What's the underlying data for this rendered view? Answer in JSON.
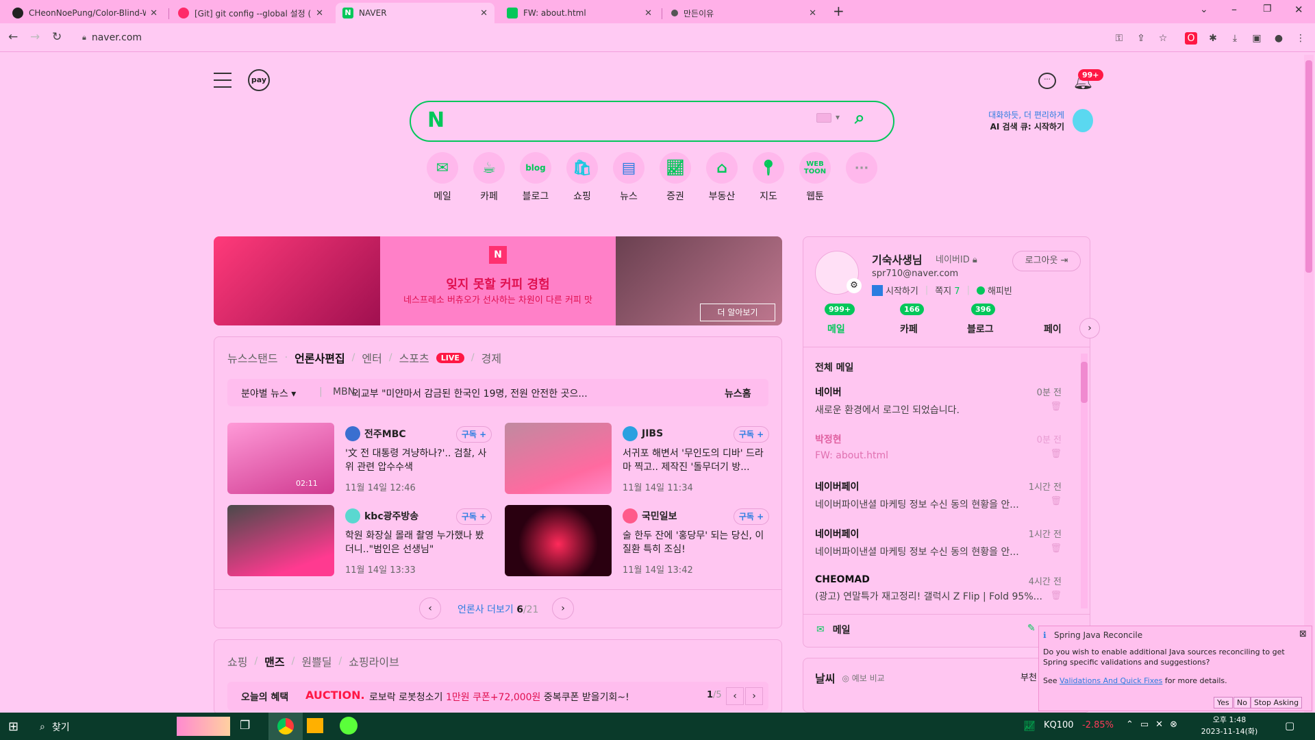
{
  "browser": {
    "tabs": [
      {
        "title": "CHeonNoePung/Color-Blind-W",
        "icon": "github-icon"
      },
      {
        "title": "[Git] git config --global 설정 (+",
        "icon": "tistory-icon"
      },
      {
        "title": "NAVER",
        "icon": "naver-icon"
      },
      {
        "title": "FW: about.html",
        "icon": "naver-mail-icon"
      },
      {
        "title": "만든이유",
        "icon": "eye-icon"
      }
    ],
    "url": "naver.com"
  },
  "naver": {
    "pay_label": "pay",
    "notif_count": "99+",
    "search_logo": "N",
    "ai_line1": "대화하듯, 더 편리하게",
    "ai_line2": "AI 검색 큐: 시작하기",
    "categories": [
      {
        "label": "메일",
        "icon": "mail-icon"
      },
      {
        "label": "카페",
        "icon": "cafe-icon"
      },
      {
        "label": "블로그",
        "icon": "blog-icon"
      },
      {
        "label": "쇼핑",
        "icon": "shopping-icon"
      },
      {
        "label": "뉴스",
        "icon": "news-icon"
      },
      {
        "label": "증권",
        "icon": "stock-icon"
      },
      {
        "label": "부동산",
        "icon": "realestate-icon"
      },
      {
        "label": "지도",
        "icon": "map-icon"
      },
      {
        "label": "웹툰",
        "icon": "webtoon-icon"
      }
    ],
    "more_icon": "···"
  },
  "ad": {
    "headline": "잊지 못할 커피 경험",
    "subline": "네스프레소 버츄오가 선사하는 차원이 다른 커피 맛",
    "cta": "더 알아보기",
    "brand_mark": "N"
  },
  "news": {
    "tabs": [
      "뉴스스탠드",
      "언론사편집",
      "엔터",
      "스포츠",
      "경제"
    ],
    "live": "LIVE",
    "ticker_category": "분야별 뉴스",
    "ticker_source": "MBN",
    "ticker_text": "외교부 \"미얀마서 감금된 한국인 19명, 전원 안전한 곳으...",
    "newshome": "뉴스홈",
    "subscribe": "구독 +",
    "items": [
      {
        "press": "전주MBC",
        "headline": "'文 전 대통령 겨냥하나?'.. 검찰, 사위 관련 압수수색",
        "date": "11월 14일 12:46",
        "video": "02:11"
      },
      {
        "press": "JIBS",
        "headline": "서귀포 해변서 '무인도의 디바' 드라마 찍고.. 제작진 '돌무더기 방...",
        "date": "11월 14일 11:34"
      },
      {
        "press": "kbc광주방송",
        "headline": "학원 화장실 몰래 촬영 누가했나 봤더니..\"범인은 선생님\"",
        "date": "11월 14일 13:33"
      },
      {
        "press": "국민일보",
        "headline": "술 한두 잔에 '홍당무' 되는 당신, 이 질환 특히 조심!",
        "date": "11월 14일 13:42"
      }
    ],
    "more_label": "언론사 더보기",
    "page": "6",
    "page_total": "/21"
  },
  "shopping": {
    "tabs": [
      "쇼핑",
      "맨즈",
      "원쁠딜",
      "쇼핑라이브"
    ],
    "promo_label": "오늘의 혜택",
    "promo_brand": "AUCTION.",
    "promo_text1": "로보락 로봇청소기",
    "promo_highlight": "1만원 쿠폰+72,000원",
    "promo_text2": "중복쿠폰 받을기회~!",
    "page": "1",
    "page_total": "/5"
  },
  "profile": {
    "name": "기숙사생님",
    "id_label": "네이버ID",
    "email": "spr710@naver.com",
    "logout": "로그아웃",
    "start": "시작하기",
    "memo_label": "쪽지",
    "memo_count": "7",
    "happybean": "해피빈",
    "services": [
      {
        "label": "메일",
        "count": "999+"
      },
      {
        "label": "카페",
        "count": "166"
      },
      {
        "label": "블로그",
        "count": "396"
      },
      {
        "label": "페이",
        "count": ""
      }
    ]
  },
  "mail": {
    "section_title": "전체 메일",
    "rows": [
      {
        "from": "네이버",
        "subject": "새로운 환경에서 로그인 되었습니다.",
        "time": "0분 전"
      },
      {
        "from": "박정현",
        "subject": "FW: about.html",
        "time": "0분 전"
      },
      {
        "from": "네이버페이",
        "subject": "네이버파이낸셜 마케팅 정보 수신 동의 현황을 안...",
        "time": "1시간 전"
      },
      {
        "from": "네이버페이",
        "subject": "네이버파이낸셜 마케팅 정보 수신 동의 현황을 안...",
        "time": "1시간 전"
      },
      {
        "from": "CHEOMAD",
        "subject": "(광고) 연말특가 재고정리! 갤럭시 Z Flip | Fold 95%...",
        "time": "4시간 전"
      }
    ],
    "footer_label": "메일"
  },
  "weather": {
    "title": "날씨",
    "compare": "예보 비교",
    "right": "부천"
  },
  "popup": {
    "title": "Spring Java Reconcile",
    "body": "Do you wish to enable additional Java sources reconciling to get Spring specific validations and suggestions?",
    "see": "See",
    "link": "Validations And Quick Fixes",
    "after": "for more details.",
    "btn_yes": "Yes",
    "btn_no": "No",
    "btn_stop": "Stop Asking"
  },
  "taskbar": {
    "search": "찾기",
    "stock_name": "KQ100",
    "stock_change": "-2.85%",
    "time": "오후 1:48",
    "date": "2023-11-14(화)"
  },
  "colors": {
    "naver_green": "#03c75a",
    "background": "#ffcaf3",
    "accent_red": "#ff1744",
    "link_blue": "#2b7de0"
  }
}
